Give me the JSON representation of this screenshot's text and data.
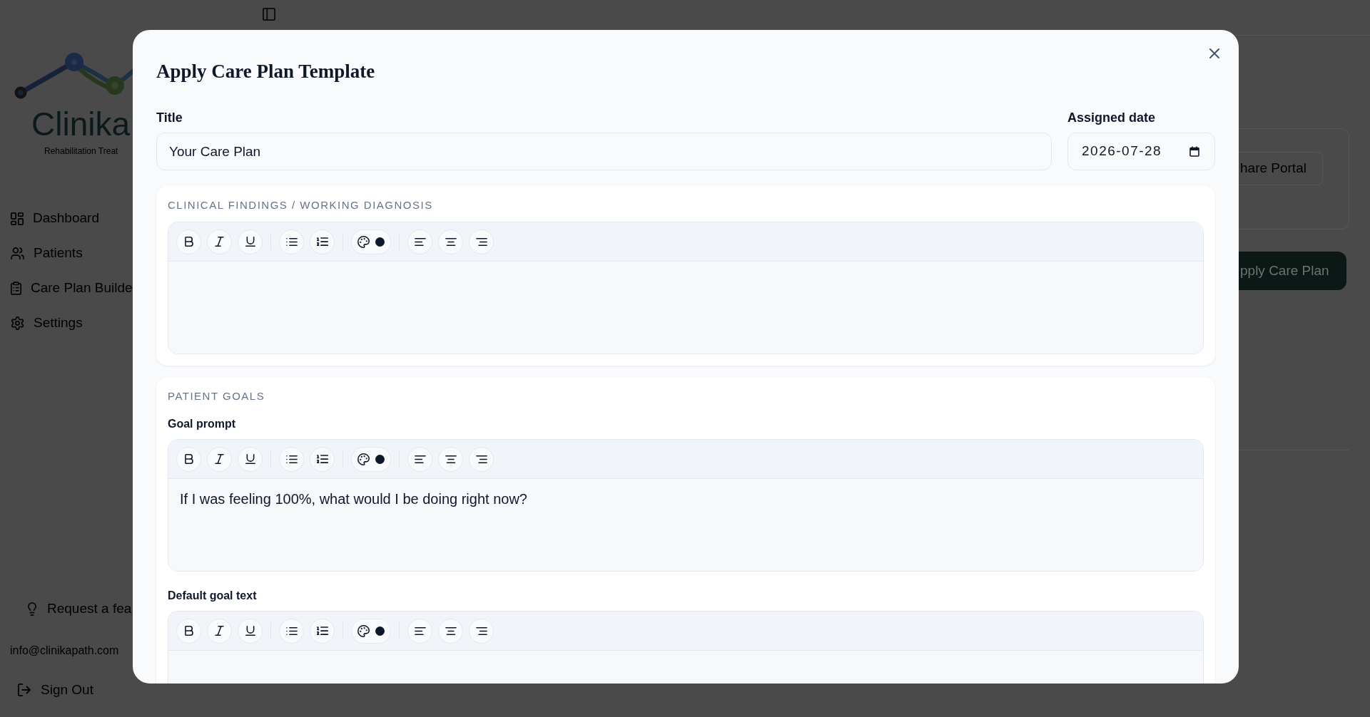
{
  "app": {
    "sidebar": {
      "logo": {
        "wordmark": "Clinika",
        "tagline": "Rehabilitation Treat"
      },
      "nav": [
        {
          "label": "Dashboard",
          "selected": false
        },
        {
          "label": "Patients",
          "selected": false
        },
        {
          "label": "Care Plan Builde",
          "selected": false
        },
        {
          "label": "Settings",
          "selected": false
        }
      ],
      "feature_request": "Request a fea",
      "email": "info@clinikapath.com",
      "sign_out": "Sign Out"
    },
    "content": {
      "share_button": "hare Portal",
      "apply_button": "pply Care Plan"
    }
  },
  "dialog": {
    "title": "Apply Care Plan Template",
    "fields": [
      {
        "kind": "text",
        "label": "Title",
        "value": "Your Care Plan"
      },
      {
        "kind": "date",
        "label": "Assigned date",
        "value": "2026-07-28"
      }
    ],
    "sections": [
      {
        "heading": "CLINICAL FINDINGS / WORKING DIAGNOSIS",
        "editors": [
          {
            "color": "#0f172a"
          }
        ]
      },
      {
        "heading": "PATIENT GOALS",
        "editors": [
          {
            "label": "Goal prompt",
            "value": "If I was feeling 100%, what would I be doing right now?",
            "color": "#0f172a"
          },
          {
            "label": "Default goal text",
            "color": "#0f172a"
          }
        ]
      }
    ]
  }
}
